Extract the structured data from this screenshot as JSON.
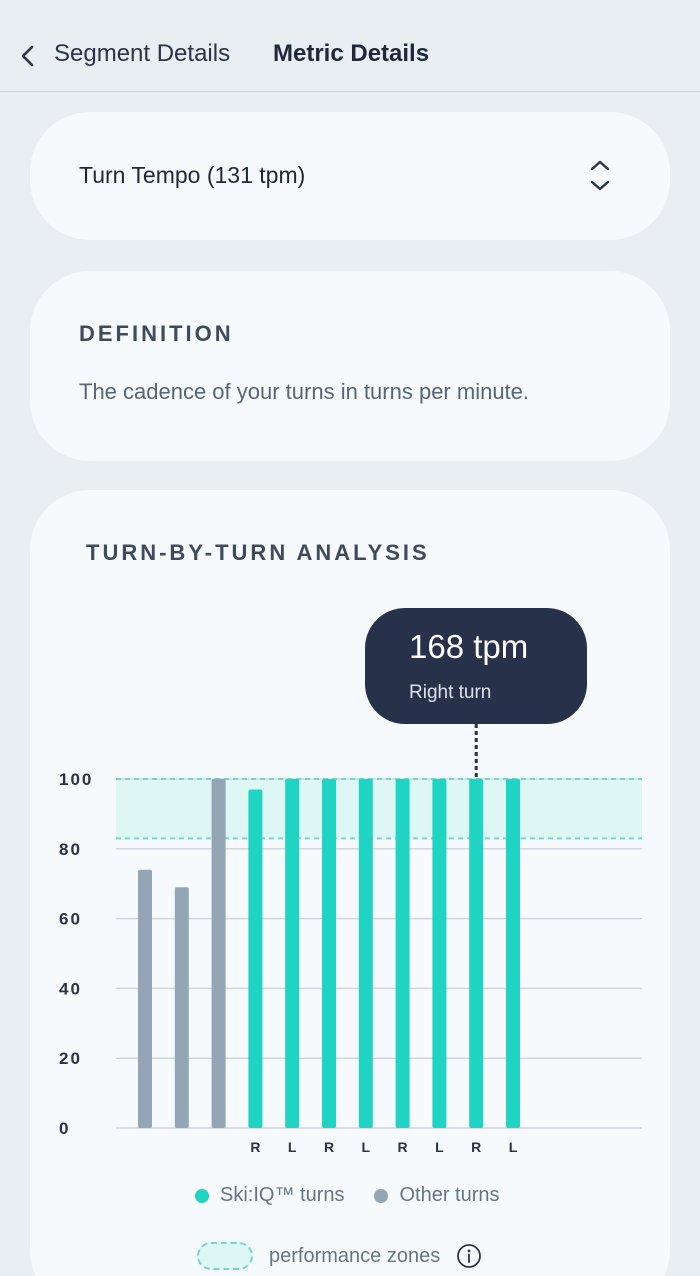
{
  "header": {
    "back_label": "Segment Details",
    "current_label": "Metric Details"
  },
  "metric_select": {
    "value": "Turn Tempo (131 tpm)"
  },
  "definition": {
    "title": "DEFINITION",
    "text": "The cadence of your turns in turns per minute."
  },
  "analysis": {
    "title": "TURN-BY-TURN ANALYSIS",
    "tooltip": {
      "value": "168 tpm",
      "label": "Right turn"
    },
    "legend": {
      "skiiq_label": "Ski:IQ™ turns",
      "other_label": "Other turns",
      "zones_label": "performance zones"
    }
  },
  "colors": {
    "skiiq": "#1fd4c3",
    "other": "#94a6b5",
    "zone_fill": "#dff7f4",
    "zone_border": "#6fd9cf",
    "tooltip_bg": "#27324a"
  },
  "chart_data": {
    "type": "bar",
    "y_ticks": [
      "0",
      "20",
      "40",
      "60",
      "80",
      "100"
    ],
    "ylim": [
      0,
      100
    ],
    "performance_zone": [
      83,
      100
    ],
    "bars": [
      {
        "value": 74,
        "kind": "other",
        "label": ""
      },
      {
        "value": 69,
        "kind": "other",
        "label": ""
      },
      {
        "value": 100,
        "kind": "other",
        "label": ""
      },
      {
        "value": 97,
        "kind": "skiiq",
        "label": "R"
      },
      {
        "value": 100,
        "kind": "skiiq",
        "label": "L"
      },
      {
        "value": 100,
        "kind": "skiiq",
        "label": "R"
      },
      {
        "value": 100,
        "kind": "skiiq",
        "label": "L"
      },
      {
        "value": 100,
        "kind": "skiiq",
        "label": "R"
      },
      {
        "value": 100,
        "kind": "skiiq",
        "label": "L"
      },
      {
        "value": 100,
        "kind": "skiiq",
        "label": "R",
        "selected": true
      },
      {
        "value": 100,
        "kind": "skiiq",
        "label": "L"
      }
    ]
  }
}
